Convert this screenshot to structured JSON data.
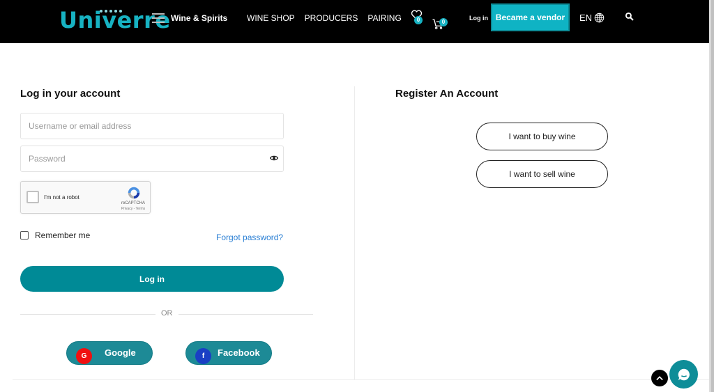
{
  "header": {
    "logo": "Univerre",
    "category_label": "Wine & Spirits",
    "nav": [
      "WINE SHOP",
      "PRODUCERS",
      "PAIRING"
    ],
    "wishlist_count": "0",
    "cart_count": "0",
    "login_label": "Log in",
    "vendor_label": "Became a vendor",
    "language": "EN",
    "accent_color": "#17b2c2"
  },
  "login": {
    "title": "Log in your account",
    "username_placeholder": "Username or email address",
    "username_value": "",
    "password_placeholder": "Password",
    "password_value": "",
    "captcha_label": "I'm not a robot",
    "captcha_brand": "reCAPTCHA",
    "captcha_terms": "Privacy - Terms",
    "remember_label": "Remember me",
    "remember_checked": false,
    "forgot_label": "Forgot password?",
    "submit_label": "Log in",
    "or_label": "OR",
    "google_label": "Google",
    "google_icon": "G",
    "facebook_label": "Facebook",
    "facebook_icon": "f"
  },
  "register": {
    "title": "Register An Account",
    "buy_label": "I want to buy wine",
    "sell_label": "I want to sell wine"
  }
}
